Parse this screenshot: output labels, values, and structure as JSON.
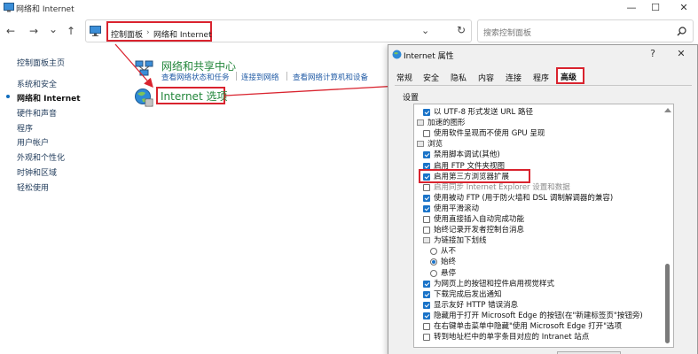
{
  "window": {
    "title": "网络和 Internet",
    "min_glyph": "—",
    "max_glyph": "☐",
    "close_glyph": "✕"
  },
  "nav": {
    "back_glyph": "←",
    "forward_glyph": "→",
    "recent_glyph": "⌄",
    "up_glyph": "↑",
    "dropdown_glyph": "⌄",
    "refresh_glyph": "↻"
  },
  "breadcrumb": {
    "part1": "控制面板",
    "sep": "›",
    "part2": "网络和 Internet"
  },
  "search": {
    "placeholder": "搜索控制面板",
    "icon": "search-icon"
  },
  "sidebar": {
    "items": [
      {
        "label": "控制面板主页"
      },
      {
        "label": "系统和安全"
      },
      {
        "label": "网络和 Internet"
      },
      {
        "label": "硬件和声音"
      },
      {
        "label": "程序"
      },
      {
        "label": "用户帐户"
      },
      {
        "label": "外观和个性化"
      },
      {
        "label": "时钟和区域"
      },
      {
        "label": "轻松使用"
      }
    ]
  },
  "main": {
    "network_center": {
      "title": "网络和共享中心",
      "links": [
        "查看网络状态和任务",
        "连接到网络",
        "查看网络计算机和设备"
      ]
    },
    "internet_options": {
      "title": "Internet 选项"
    }
  },
  "dialog": {
    "title": "Internet 属性",
    "help_glyph": "?",
    "close_glyph": "✕",
    "tabs": [
      "常规",
      "安全",
      "隐私",
      "内容",
      "连接",
      "程序",
      "高级"
    ],
    "active_tab": "高级",
    "settings_label": "设置",
    "rows": [
      {
        "type": "checkbox",
        "checked": true,
        "indent": 1,
        "label": "以 UTF-8 形式发送 URL 路径"
      },
      {
        "type": "folder",
        "indent": 0,
        "label": "加速的图形"
      },
      {
        "type": "checkbox",
        "checked": false,
        "indent": 1,
        "label": "使用软件呈现而不使用 GPU 呈现"
      },
      {
        "type": "folder",
        "indent": 0,
        "label": "浏览"
      },
      {
        "type": "checkbox",
        "checked": true,
        "indent": 1,
        "label": "禁用脚本调试(其他)"
      },
      {
        "type": "checkbox",
        "checked": true,
        "indent": 1,
        "label": "启用 FTP 文件夹视图"
      },
      {
        "type": "checkbox",
        "checked": true,
        "indent": 1,
        "label": "启用第三方浏览器扩展"
      },
      {
        "type": "checkbox",
        "checked": false,
        "indent": 1,
        "label": "启用同步 Internet Explorer 设置和数据",
        "grey": true
      },
      {
        "type": "checkbox",
        "checked": true,
        "indent": 1,
        "label": "使用被动 FTP (用于防火墙和 DSL 调制解调器的兼容)"
      },
      {
        "type": "checkbox",
        "checked": true,
        "indent": 1,
        "label": "使用平滑滚动"
      },
      {
        "type": "checkbox",
        "checked": false,
        "indent": 1,
        "label": "使用直接插入自动完成功能"
      },
      {
        "type": "checkbox",
        "checked": false,
        "indent": 1,
        "label": "始终记录开发者控制台消息"
      },
      {
        "type": "folder",
        "indent": 1,
        "label": "为链接加下划线"
      },
      {
        "type": "radio",
        "checked": false,
        "indent": 2,
        "label": "从不"
      },
      {
        "type": "radio",
        "checked": true,
        "indent": 2,
        "label": "始终"
      },
      {
        "type": "radio",
        "checked": false,
        "indent": 2,
        "label": "悬停"
      },
      {
        "type": "checkbox",
        "checked": true,
        "indent": 1,
        "label": "为网页上的按钮和控件启用视觉样式"
      },
      {
        "type": "checkbox",
        "checked": true,
        "indent": 1,
        "label": "下载完成后发出通知"
      },
      {
        "type": "checkbox",
        "checked": true,
        "indent": 1,
        "label": "显示友好 HTTP 错误消息"
      },
      {
        "type": "checkbox",
        "checked": true,
        "indent": 1,
        "label": "隐藏用于打开 Microsoft Edge 的按钮(在\"新建标签页\"按钮旁)"
      },
      {
        "type": "checkbox",
        "checked": false,
        "indent": 1,
        "label": "在右键单击菜单中隐藏\"使用 Microsoft Edge 打开\"选项"
      },
      {
        "type": "checkbox",
        "checked": false,
        "indent": 1,
        "label": "转到地址栏中的单字条目对应的 Intranet 站点"
      }
    ]
  },
  "colors": {
    "annotation_red": "#d9232e",
    "link_green": "#22863a",
    "link_blue": "#1f5aa5",
    "accent_blue": "#1a73c8"
  }
}
